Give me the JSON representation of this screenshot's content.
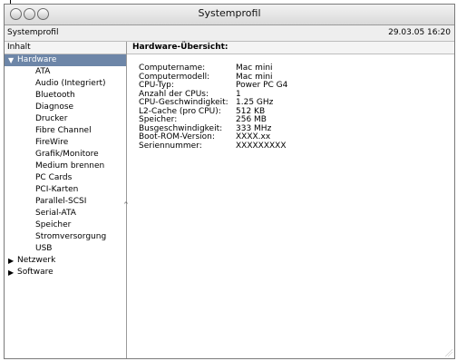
{
  "window": {
    "title": "Systemprofil"
  },
  "header": {
    "left": "Systemprofil",
    "right": "29.03.05 16:20"
  },
  "sidebar": {
    "column_header": "Inhalt",
    "items": [
      {
        "label": "Hardware",
        "level": 0,
        "expanded": true,
        "selected": true
      },
      {
        "label": "ATA",
        "level": 1
      },
      {
        "label": "Audio (Integriert)",
        "level": 1
      },
      {
        "label": "Bluetooth",
        "level": 1
      },
      {
        "label": "Diagnose",
        "level": 1
      },
      {
        "label": "Drucker",
        "level": 1
      },
      {
        "label": "Fibre Channel",
        "level": 1
      },
      {
        "label": "FireWire",
        "level": 1
      },
      {
        "label": "Grafik/Monitore",
        "level": 1
      },
      {
        "label": "Medium brennen",
        "level": 1
      },
      {
        "label": "PC Cards",
        "level": 1
      },
      {
        "label": "PCI-Karten",
        "level": 1
      },
      {
        "label": "Parallel-SCSI",
        "level": 1
      },
      {
        "label": "Serial-ATA",
        "level": 1
      },
      {
        "label": "Speicher",
        "level": 1
      },
      {
        "label": "Stromversorgung",
        "level": 1
      },
      {
        "label": "USB",
        "level": 1
      },
      {
        "label": "Netzwerk",
        "level": 0,
        "expanded": false
      },
      {
        "label": "Software",
        "level": 0,
        "expanded": false
      }
    ]
  },
  "main": {
    "column_header": "Hardware-Übersicht:",
    "fields": [
      {
        "key": "Computername:",
        "value": "Mac mini"
      },
      {
        "key": "Computermodell:",
        "value": "Mac mini"
      },
      {
        "key": "CPU-Typ:",
        "value": "Power PC G4"
      },
      {
        "key": "Anzahl der CPUs:",
        "value": "1"
      },
      {
        "key": "CPU-Geschwindigkeit:",
        "value": "1.25 GHz"
      },
      {
        "key": "L2-Cache (pro CPU):",
        "value": "512 KB"
      },
      {
        "key": "Speicher:",
        "value": "256 MB"
      },
      {
        "key": "Busgeschwindigkeit:",
        "value": "333 MHz"
      },
      {
        "key": "Boot-ROM-Version:",
        "value": "XXXX.xx"
      },
      {
        "key": "Seriennummer:",
        "value": "XXXXXXXXX"
      }
    ]
  },
  "colors": {
    "selection": "#6d86a8"
  }
}
